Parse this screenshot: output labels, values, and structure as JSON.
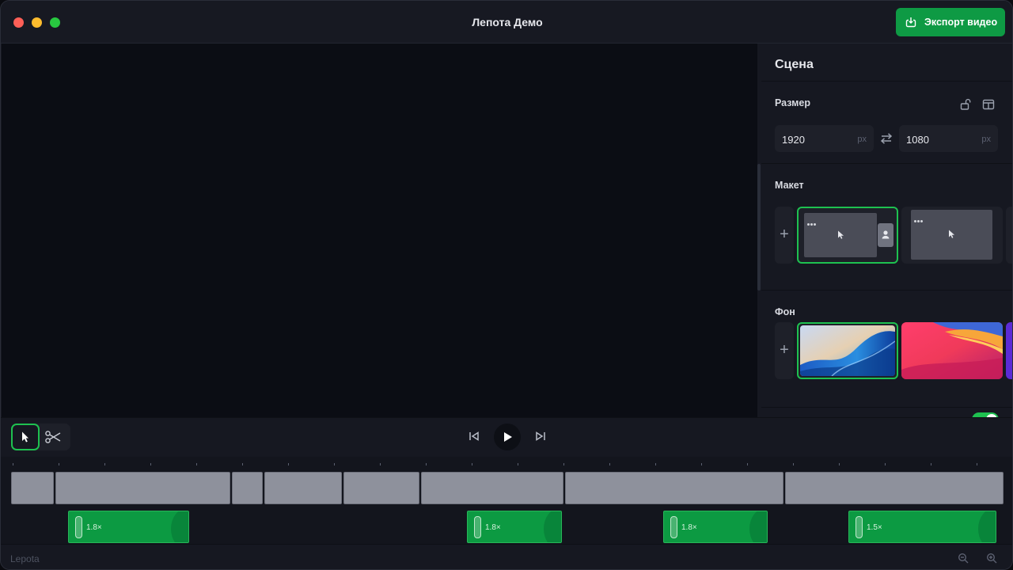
{
  "window": {
    "title": "Лепота Демо",
    "export_label": "Экспорт видео"
  },
  "sidebar": {
    "heading": "Сцена",
    "size": {
      "title": "Размер",
      "width": "1920",
      "height": "1080",
      "unit": "px"
    },
    "layout": {
      "title": "Макет"
    },
    "background": {
      "title": "Фон"
    },
    "add_symbol": "+"
  },
  "timeline": {
    "zoom_segments": [
      {
        "label": "1.8×"
      },
      {
        "label": "1.8×"
      },
      {
        "label": "1.8×"
      },
      {
        "label": "1.5×"
      }
    ]
  },
  "status": {
    "brand": "Lepota"
  },
  "colors": {
    "accent": "#0e9a44",
    "selection": "#1ec150"
  }
}
